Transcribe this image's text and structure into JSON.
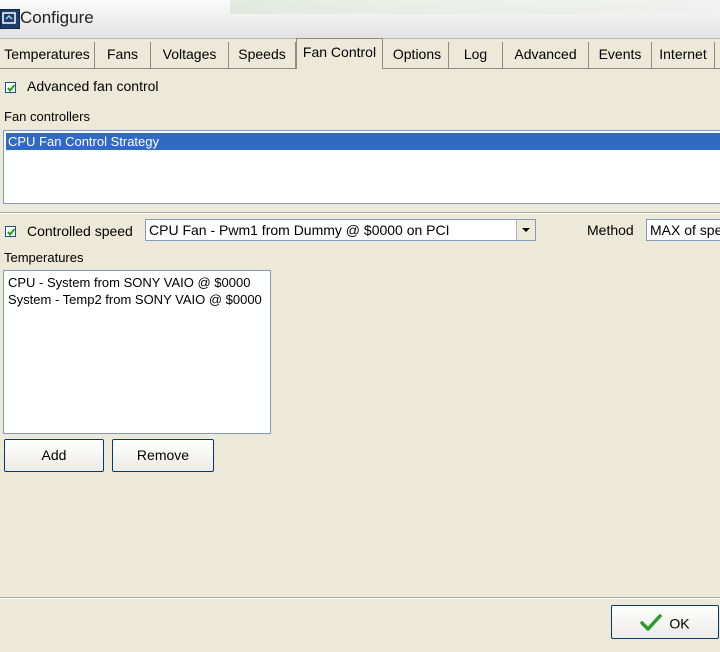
{
  "window": {
    "title": "Configure"
  },
  "tabs": [
    {
      "label": "Temperatures"
    },
    {
      "label": "Fans"
    },
    {
      "label": "Voltages"
    },
    {
      "label": "Speeds"
    },
    {
      "label": "Fan Control",
      "active": true
    },
    {
      "label": "Options"
    },
    {
      "label": "Log"
    },
    {
      "label": "Advanced"
    },
    {
      "label": "Events"
    },
    {
      "label": "Internet"
    }
  ],
  "advanced_fan_control": {
    "label": "Advanced fan control",
    "checked": true
  },
  "fan_controllers": {
    "label": "Fan controllers",
    "items": [
      {
        "label": "CPU Fan Control Strategy",
        "selected": true
      }
    ]
  },
  "controlled_speed": {
    "label": "Controlled speed",
    "checked": true,
    "selected": "CPU Fan - Pwm1 from Dummy @ $0000 on PCI"
  },
  "method": {
    "label": "Method",
    "selected": "MAX of speeds"
  },
  "temperatures": {
    "label": "Temperatures",
    "items": [
      {
        "label": "CPU - System from SONY VAIO @ $0000"
      },
      {
        "label": "System - Temp2 from SONY VAIO @ $0000"
      }
    ]
  },
  "buttons": {
    "add": "Add",
    "remove": "Remove",
    "ok": "OK"
  },
  "colors": {
    "selection": "#316ac5",
    "ok_check": "#2e9a2e"
  }
}
